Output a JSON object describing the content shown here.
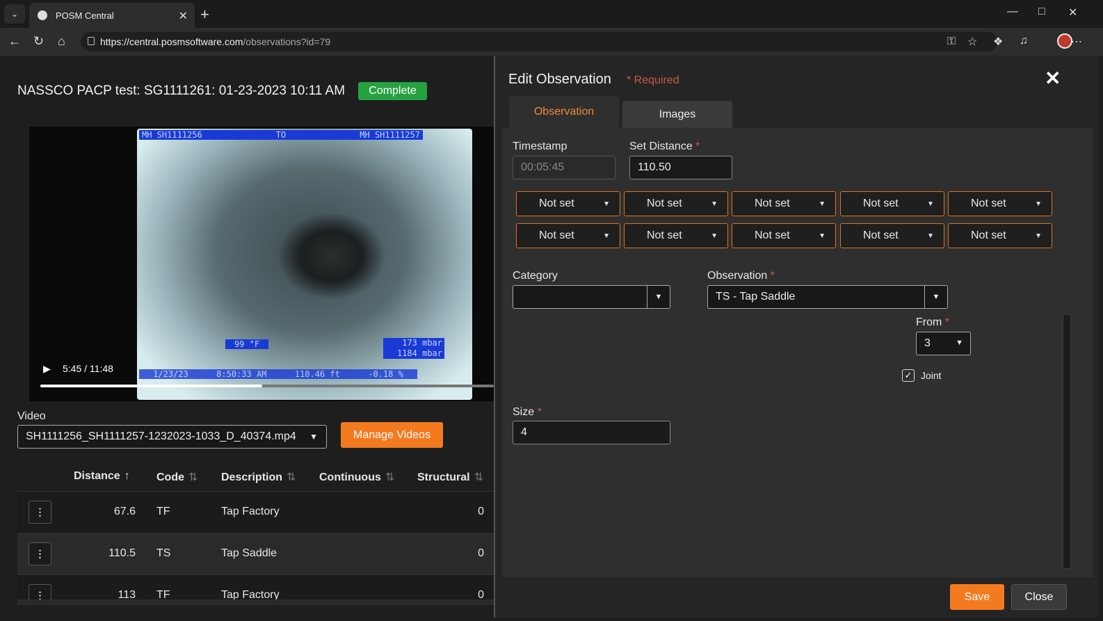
{
  "browser": {
    "tab_title": "POSM Central",
    "url_host": "https://central.posmsoftware.com",
    "url_path": "/observations?id=79"
  },
  "inspection": {
    "title": "NASSCO PACP test: SG1111261: 01-23-2023 10:11 AM",
    "status": "Complete"
  },
  "video": {
    "osd_from": "MH SH1111256",
    "osd_to": "TO",
    "osd_dest": "MH SH1111257",
    "osd_temp": "99 °F",
    "osd_pressure_1": "173 mbar",
    "osd_pressure_2": "1184 mbar",
    "osd_date": "1/23/23",
    "osd_time": "8:50:33 AM",
    "osd_dist": "110.46 ft",
    "osd_incl": "-0.18 %",
    "time_display": "5:45 / 11:48",
    "progress": 0.49,
    "label": "Video",
    "selected": "SH1111256_SH1111257-1232023-1033_D_40374.mp4",
    "manage_button": "Manage Videos"
  },
  "table": {
    "headers": [
      "Distance",
      "Code",
      "Description",
      "Continuous",
      "Structural"
    ],
    "rows": [
      {
        "distance": "67.6",
        "code": "TF",
        "description": "Tap Factory",
        "continuous": "",
        "structural": "0"
      },
      {
        "distance": "110.5",
        "code": "TS",
        "description": "Tap Saddle",
        "continuous": "",
        "structural": "0"
      },
      {
        "distance": "113",
        "code": "TF",
        "description": "Tap Factory",
        "continuous": "",
        "structural": "0"
      }
    ]
  },
  "modal": {
    "title": "Edit Observation",
    "required_note": "* Required",
    "tabs": [
      "Observation",
      "Images"
    ],
    "timestamp_label": "Timestamp",
    "timestamp_value": "00:05:45",
    "set_distance_label": "Set Distance",
    "set_distance_value": "110.50",
    "not_set": "Not set",
    "category_label": "Category",
    "category_value": "",
    "observation_label": "Observation",
    "observation_value": "TS - Tap Saddle",
    "from_label": "From",
    "from_value": "3",
    "joint_label": "Joint",
    "size_label": "Size",
    "size_value": "4",
    "save_button": "Save",
    "close_button": "Close"
  }
}
